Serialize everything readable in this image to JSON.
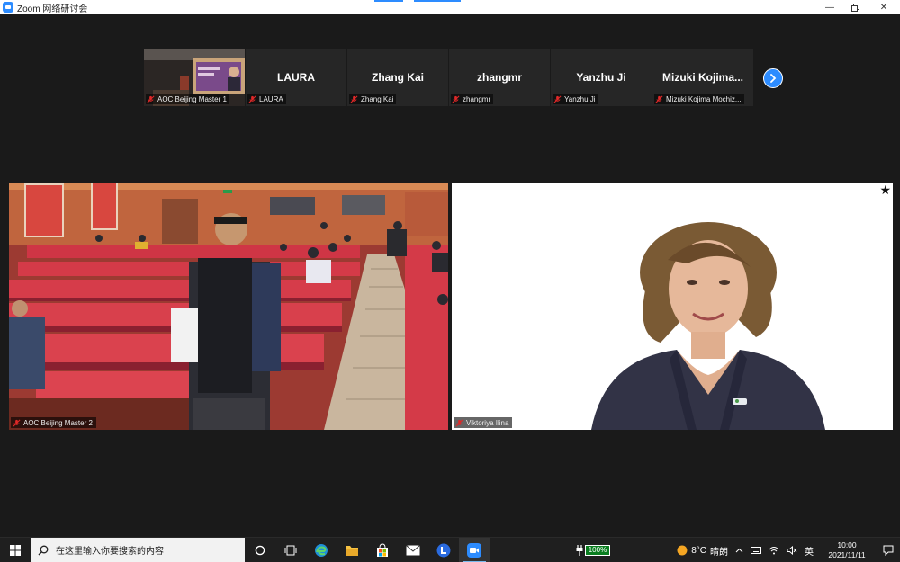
{
  "window": {
    "title": "Zoom 网络研讨会"
  },
  "gallery": {
    "tiles": [
      {
        "name": "",
        "label": "AOC Beijing Master 1",
        "has_video": true
      },
      {
        "name": "LAURA",
        "label": "LAURA",
        "has_video": false
      },
      {
        "name": "Zhang Kai",
        "label": "Zhang Kai",
        "has_video": false
      },
      {
        "name": "zhangmr",
        "label": "zhangmr",
        "has_video": false
      },
      {
        "name": "Yanzhu Ji",
        "label": "Yanzhu Ji",
        "has_video": false
      },
      {
        "name": "Mizuki  Kojima...",
        "label": "Mizuki Kojima Mochiz...",
        "has_video": false
      }
    ],
    "next_icon": "chevron-right-icon"
  },
  "videos": {
    "left": {
      "label": "AOC Beijing Master 2"
    },
    "right": {
      "label": "Viktoriya Ilina"
    }
  },
  "taskbar": {
    "search_placeholder": "在这里输入你要搜索的内容",
    "battery": "100%",
    "weather_temp": "8°C",
    "weather_desc": "晴朗",
    "ime": "英",
    "time": "10:00",
    "date": "2021/11/11"
  },
  "colors": {
    "zoom_blue": "#2d8cff",
    "mic_off_red": "#e02828",
    "battery_green": "#0a7d1f"
  }
}
